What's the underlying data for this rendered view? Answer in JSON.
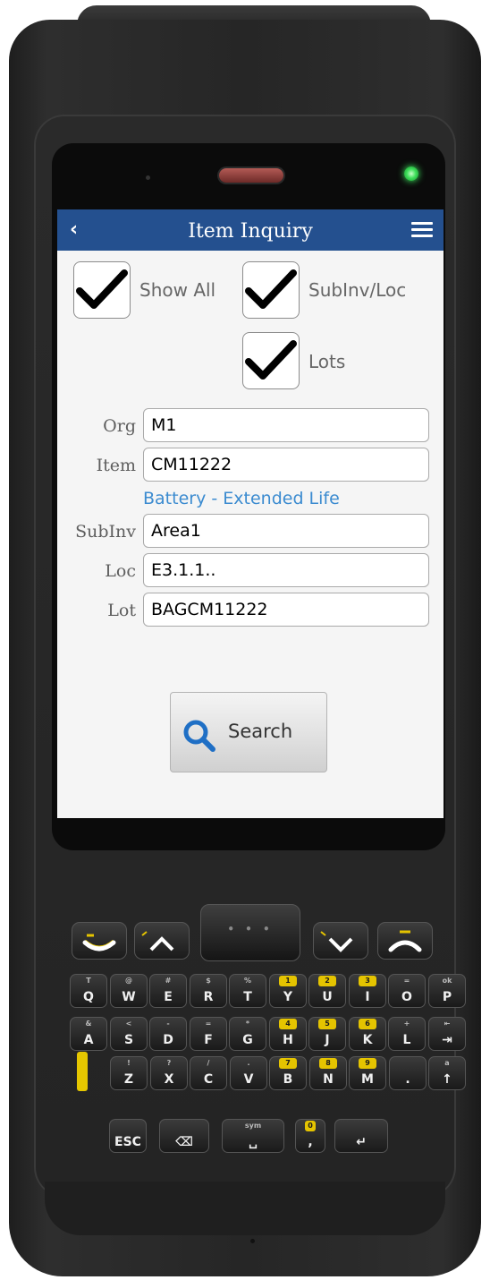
{
  "header": {
    "title": "Item Inquiry"
  },
  "checkboxes": [
    {
      "label": "Show All",
      "checked": true
    },
    {
      "label": "SubInv/Loc",
      "checked": true
    },
    {
      "label": "Lots",
      "checked": true
    }
  ],
  "fields": {
    "org": {
      "label": "Org",
      "value": "M1"
    },
    "item": {
      "label": "Item",
      "value": "CM11222"
    },
    "item_description": "Battery - Extended Life",
    "subinv": {
      "label": "SubInv",
      "value": "Area1"
    },
    "loc": {
      "label": "Loc",
      "value": "E3.1.1.."
    },
    "lot": {
      "label": "Lot",
      "value": "BAGCM11222"
    }
  },
  "search_button": {
    "label": "Search"
  },
  "keypad": {
    "row1": [
      {
        "main": "Q",
        "sub": "T"
      },
      {
        "main": "W",
        "sub": "@"
      },
      {
        "main": "E",
        "sub": "#"
      },
      {
        "main": "R",
        "sub": "$"
      },
      {
        "main": "T",
        "sub": "%"
      },
      {
        "main": "Y",
        "sub": "1",
        "yellow": true
      },
      {
        "main": "U",
        "sub": "2",
        "yellow": true
      },
      {
        "main": "I",
        "sub": "3",
        "yellow": true
      },
      {
        "main": "O",
        "sub": "="
      },
      {
        "main": "P",
        "sub": "ok"
      }
    ],
    "row2": [
      {
        "main": "A",
        "sub": "&"
      },
      {
        "main": "S",
        "sub": "<"
      },
      {
        "main": "D",
        "sub": "-"
      },
      {
        "main": "F",
        "sub": "="
      },
      {
        "main": "G",
        "sub": "*"
      },
      {
        "main": "H",
        "sub": "4",
        "yellow": true
      },
      {
        "main": "J",
        "sub": "5",
        "yellow": true
      },
      {
        "main": "K",
        "sub": "6",
        "yellow": true
      },
      {
        "main": "L",
        "sub": "+"
      },
      {
        "main": "⇥",
        "sub": "⇤"
      }
    ],
    "row3": [
      {
        "main": "Z",
        "sub": "!"
      },
      {
        "main": "X",
        "sub": "?"
      },
      {
        "main": "C",
        "sub": "/"
      },
      {
        "main": "V",
        "sub": "."
      },
      {
        "main": "B",
        "sub": "7",
        "yellow": true
      },
      {
        "main": "N",
        "sub": "8",
        "yellow": true
      },
      {
        "main": "M",
        "sub": "9",
        "yellow": true
      },
      {
        "main": ".",
        "sub": ""
      },
      {
        "main": "↑",
        "sub": "a"
      }
    ],
    "row4": [
      {
        "main": "ESC",
        "sub": ""
      },
      {
        "main": "⌫",
        "sub": ""
      },
      {
        "main": "␣",
        "sub": "sym"
      },
      {
        "main": ",",
        "sub": "0",
        "yellow": true
      },
      {
        "main": "↵",
        "sub": ""
      }
    ],
    "center_dots": "• • •"
  }
}
